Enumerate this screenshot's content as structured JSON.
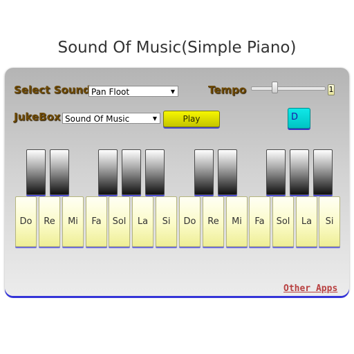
{
  "title": "Sound Of Music(Simple Piano)",
  "controls": {
    "select_sound_label": "Select Sound",
    "select_sound_value": "Pan Floot",
    "tempo_label": "Tempo",
    "tempo_value": "1",
    "tempo_slider_fraction": 0.3,
    "jukebox_label": "JukeBox",
    "jukebox_value": "Sound Of Music",
    "play_label": "Play",
    "d_button_label": "D"
  },
  "keys": {
    "white": [
      "Do",
      "Re",
      "Mi",
      "Fa",
      "Sol",
      "La",
      "Si",
      "Do",
      "Re",
      "Mi",
      "Fa",
      "Sol",
      "La",
      "Si"
    ],
    "black_count": 10
  },
  "footer": {
    "other_apps": "Other Apps"
  },
  "colors": {
    "label_brown": "#6e4a06",
    "play_yellow": "#f0f000",
    "d_cyan": "#00d8d8",
    "accent_blue": "#3434d8",
    "link_red": "#b84040"
  }
}
